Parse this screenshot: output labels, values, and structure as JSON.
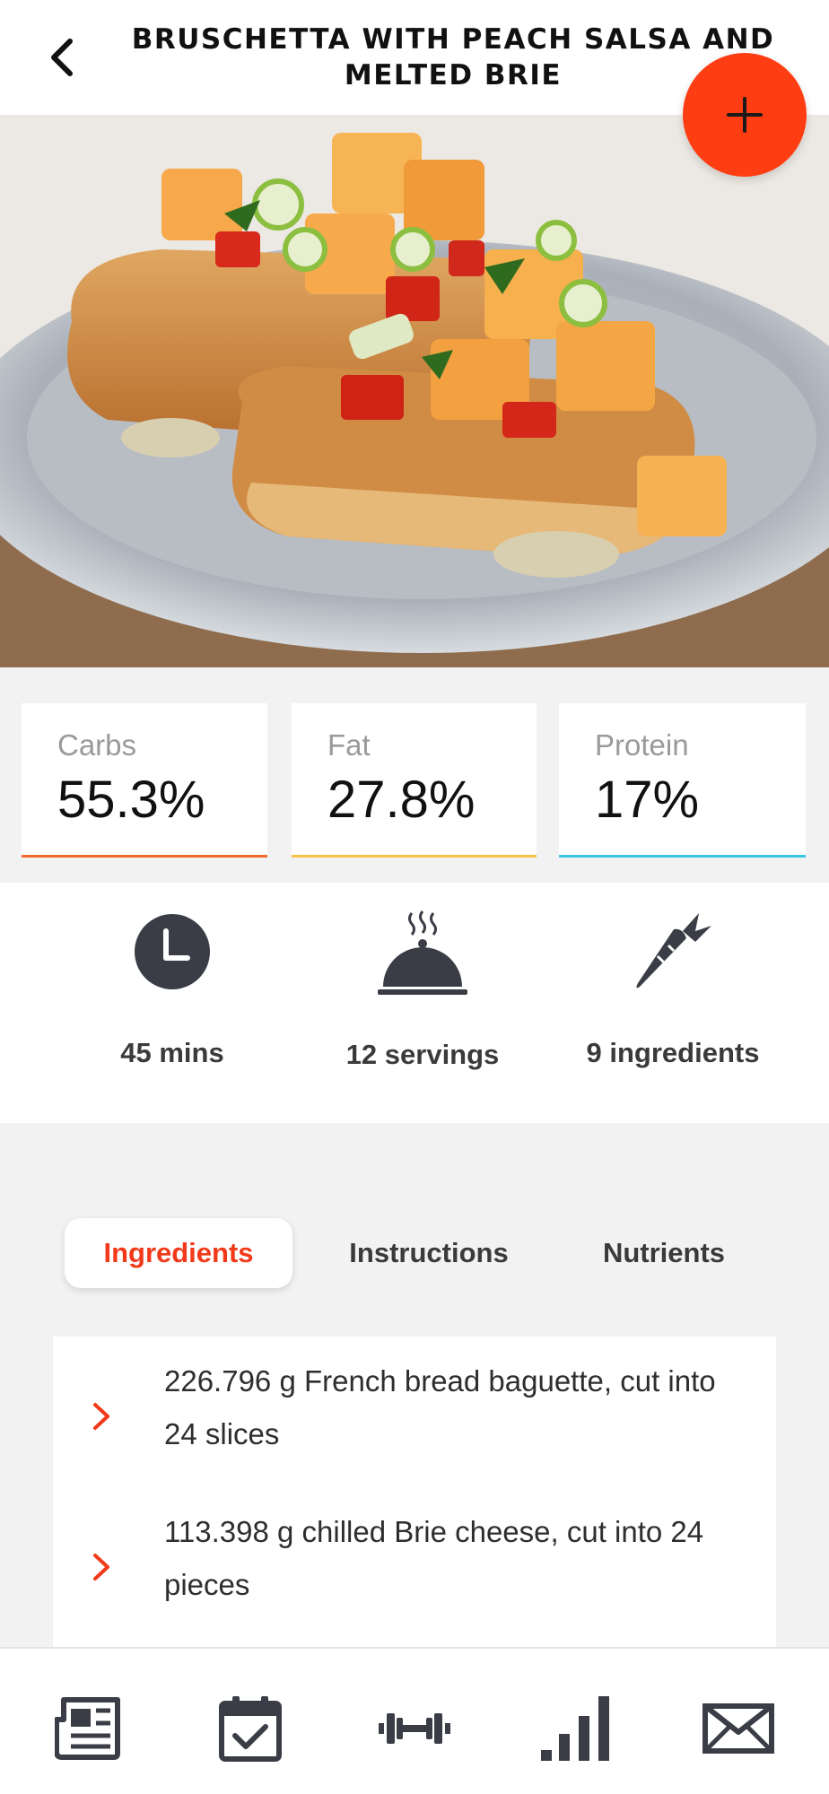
{
  "header": {
    "title": "BRUSCHETTA WITH PEACH SALSA AND MELTED BRIE",
    "back_icon": "chevron-left-icon",
    "add_icon": "plus-icon"
  },
  "colors": {
    "accent": "#ff3d12",
    "carbs": "#f26a2e",
    "fat": "#f6c24a",
    "protein": "#3bc6e3"
  },
  "macros": [
    {
      "label": "Carbs",
      "value": "55.3%"
    },
    {
      "label": "Fat",
      "value": "27.8%"
    },
    {
      "label": "Protein",
      "value": "17%"
    }
  ],
  "info": [
    {
      "icon": "clock-icon",
      "text": "45 mins"
    },
    {
      "icon": "serving-dish-icon",
      "text": "12 servings"
    },
    {
      "icon": "carrot-icon",
      "text": "9 ingredients"
    }
  ],
  "tabs": [
    {
      "label": "Ingredients",
      "active": true
    },
    {
      "label": "Instructions",
      "active": false
    },
    {
      "label": "Nutrients",
      "active": false
    }
  ],
  "ingredients": [
    {
      "text": "226.796 g French bread baguette, cut into 24 slices"
    },
    {
      "text": "113.398 g chilled Brie cheese, cut into 24 pieces"
    }
  ],
  "bottom_nav": [
    {
      "icon": "newspaper-icon"
    },
    {
      "icon": "calendar-check-icon"
    },
    {
      "icon": "dumbbell-icon"
    },
    {
      "icon": "bar-chart-icon"
    },
    {
      "icon": "mail-icon"
    }
  ]
}
